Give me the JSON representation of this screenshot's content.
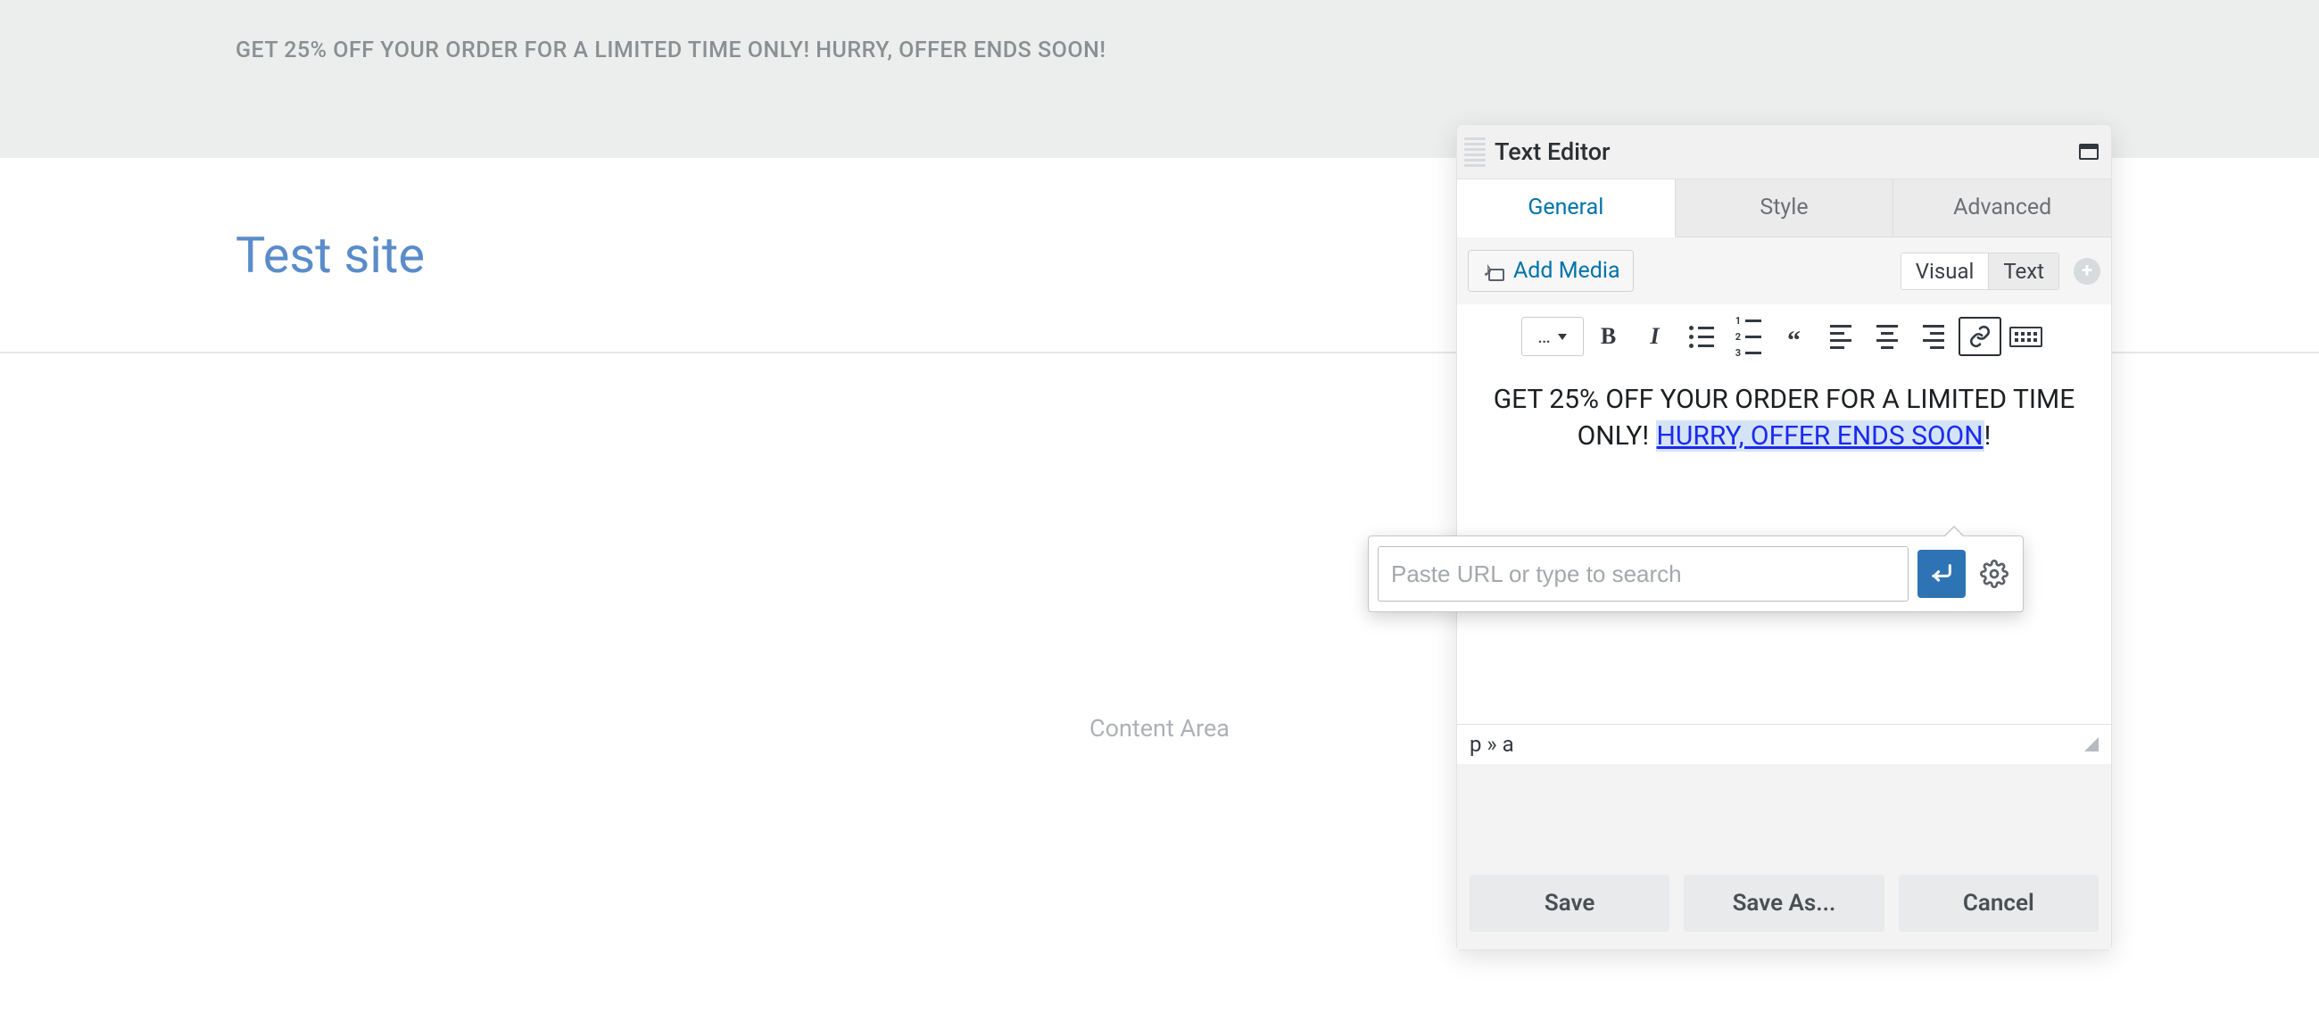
{
  "banner": {
    "text": "GET 25% OFF YOUR ORDER FOR A LIMITED TIME ONLY! HURRY, OFFER ENDS SOON!"
  },
  "site": {
    "title": "Test site"
  },
  "content_area": {
    "label": "Content Area"
  },
  "editor": {
    "title": "Text Editor",
    "tabs": {
      "general": "General",
      "style": "Style",
      "advanced": "Advanced"
    },
    "add_media": "Add Media",
    "mode": {
      "visual": "Visual",
      "text": "Text"
    },
    "paragraph_dropdown": "…",
    "body": {
      "plain_part1": "GET 25% OFF YOUR ORDER FOR A LIMITED TIME ONLY! ",
      "linked": "HURRY, OFFER ENDS SOON",
      "plain_part2": "!"
    },
    "path": "p » a"
  },
  "link_popover": {
    "placeholder": "Paste URL or type to search"
  },
  "footer": {
    "save": "Save",
    "save_as": "Save As...",
    "cancel": "Cancel"
  }
}
